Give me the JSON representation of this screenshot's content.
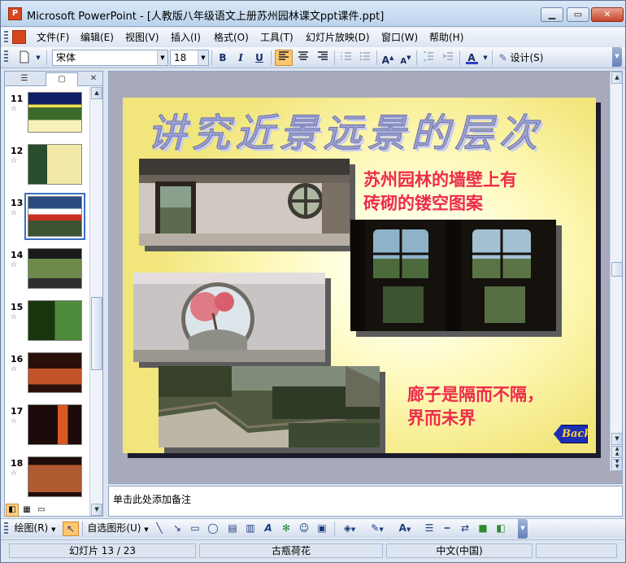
{
  "window": {
    "title": "Microsoft PowerPoint - [人教版八年级语文上册苏州园林课文ppt课件.ppt]",
    "minimize_glyph": "▁",
    "maximize_glyph": "▭",
    "close_glyph": "✕"
  },
  "menu": [
    "文件(F)",
    "编辑(E)",
    "视图(V)",
    "插入(I)",
    "格式(O)",
    "工具(T)",
    "幻灯片放映(D)",
    "窗口(W)",
    "帮助(H)"
  ],
  "toolbar": {
    "font_name": "宋体",
    "font_size": "18",
    "bold": "B",
    "italic": "I",
    "underline": "U",
    "design_label": "设计(S)",
    "font_color": "#2c3fbf",
    "font_color_glyph": "A",
    "increase_font_glyph": "A",
    "decrease_font_glyph": "A"
  },
  "panel": {
    "tab_outline": "☰",
    "tab_slides": "▢",
    "close": "✕",
    "slide_numbers": [
      "11",
      "12",
      "13",
      "14",
      "15",
      "16",
      "17",
      "18"
    ],
    "selected_slide": "13",
    "star_glyph": "☆"
  },
  "slide": {
    "title": "讲究近景远景的层次",
    "caption_1_line_1": "苏州园林的墙壁上有",
    "caption_1_line_2": "砖砌的镂空图案",
    "caption_2_line_1": "廊子是隔而不隔，",
    "caption_2_line_2": "界而未界",
    "back_button": "Back"
  },
  "notes": {
    "placeholder": "单击此处添加备注"
  },
  "drawbar": {
    "draw_label": "绘图(R)",
    "autoshape_label": "自选图形(U)"
  },
  "status": {
    "slide_info": "幻灯片 13 / 23",
    "design_template": "古瓶荷花",
    "language": "中文(中国)"
  }
}
